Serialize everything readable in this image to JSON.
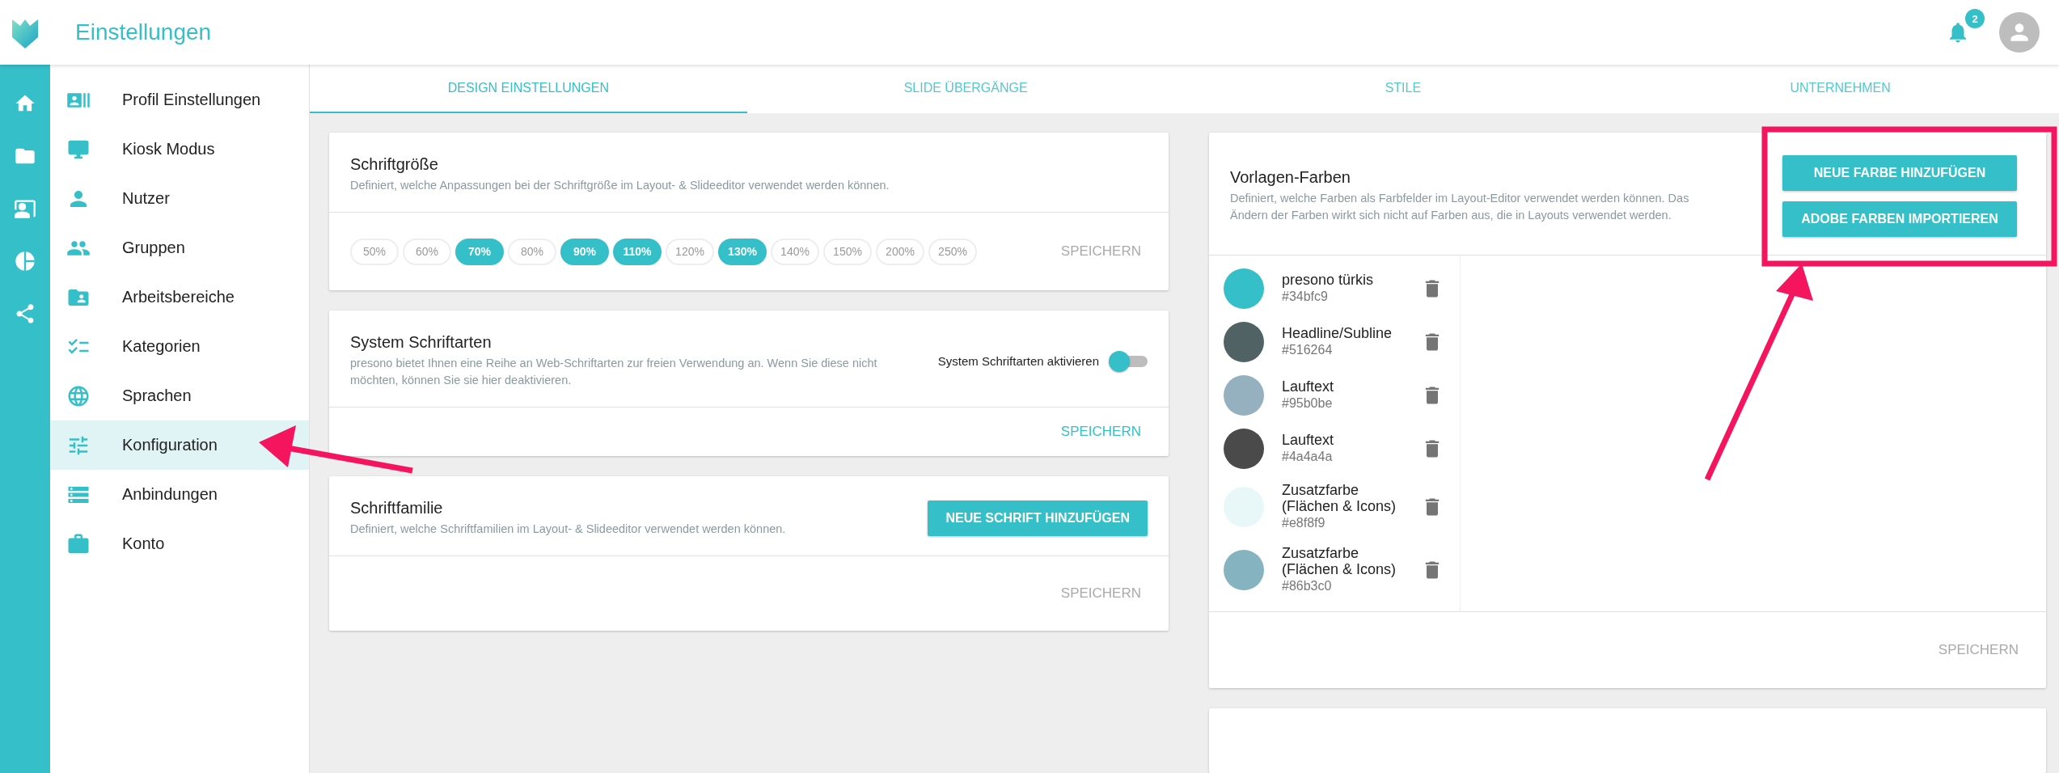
{
  "app": {
    "title": "Einstellungen",
    "notifications": "2"
  },
  "sidebar": {
    "items": [
      {
        "label": "Profil Einstellungen",
        "selected": false
      },
      {
        "label": "Kiosk Modus",
        "selected": false
      },
      {
        "label": "Nutzer",
        "selected": false
      },
      {
        "label": "Gruppen",
        "selected": false
      },
      {
        "label": "Arbeitsbereiche",
        "selected": false
      },
      {
        "label": "Kategorien",
        "selected": false
      },
      {
        "label": "Sprachen",
        "selected": false
      },
      {
        "label": "Konfiguration",
        "selected": true
      },
      {
        "label": "Anbindungen",
        "selected": false
      },
      {
        "label": "Konto",
        "selected": false
      }
    ]
  },
  "tabs": [
    {
      "label": "DESIGN EINSTELLUNGEN",
      "selected": true
    },
    {
      "label": "SLIDE ÜBERGÄNGE",
      "selected": false
    },
    {
      "label": "STILE",
      "selected": false
    },
    {
      "label": "UNTERNEHMEN",
      "selected": false
    }
  ],
  "font_size_card": {
    "title": "Schriftgröße",
    "description": "Definiert, welche Anpassungen bei der Schriftgröße im Layout- & Slideeditor verwendet werden können.",
    "options": [
      {
        "label": "50%",
        "selected": false
      },
      {
        "label": "60%",
        "selected": false
      },
      {
        "label": "70%",
        "selected": true
      },
      {
        "label": "80%",
        "selected": false
      },
      {
        "label": "90%",
        "selected": true
      },
      {
        "label": "110%",
        "selected": true
      },
      {
        "label": "120%",
        "selected": false
      },
      {
        "label": "130%",
        "selected": true
      },
      {
        "label": "140%",
        "selected": false
      },
      {
        "label": "150%",
        "selected": false
      },
      {
        "label": "200%",
        "selected": false
      },
      {
        "label": "250%",
        "selected": false
      }
    ],
    "save": "SPEICHERN"
  },
  "system_fonts_card": {
    "title": "System Schriftarten",
    "description": "presono bietet Ihnen eine Reihe an Web-Schriftarten zur freien Verwendung an. Wenn Sie diese nicht möchten, können Sie sie hier deaktivieren.",
    "toggle": {
      "label": "System Schriftarten aktivieren",
      "on": true
    },
    "save": "SPEICHERN"
  },
  "font_family_card": {
    "title": "Schriftfamilie",
    "description": "Definiert, welche Schriftfamilien im Layout- & Slideeditor verwendet werden können.",
    "add_button": "NEUE SCHRIFT HINZUFÜGEN",
    "save": "SPEICHERN"
  },
  "colors_card": {
    "title": "Vorlagen-Farben",
    "description": "Definiert, welche Farben als Farbfelder im Layout-Editor verwendet werden können. Das Ändern der Farben wirkt sich nicht auf Farben aus, die in Layouts verwendet werden.",
    "buttons": [
      "NEUE FARBE HINZUFÜGEN",
      "ADOBE FARBEN IMPORTIEREN"
    ],
    "colors": [
      {
        "name": "presono türkis",
        "hex": "#34bfc9",
        "color": "#34bfc9"
      },
      {
        "name": "Headline/Subline",
        "hex": "#516264",
        "color": "#516264"
      },
      {
        "name": "Lauftext",
        "hex": "#95b0be",
        "color": "#95b0be"
      },
      {
        "name": "Lauftext",
        "hex": "#4a4a4a",
        "color": "#4a4a4a"
      },
      {
        "name": "Zusatzfarbe (Flächen & Icons)",
        "hex": "#e8f8f9",
        "color": "#e8f8f9"
      },
      {
        "name": "Zusatzfarbe (Flächen & Icons)",
        "hex": "#86b3c0",
        "color": "#86b3c0"
      }
    ],
    "save": "SPEICHERN"
  }
}
